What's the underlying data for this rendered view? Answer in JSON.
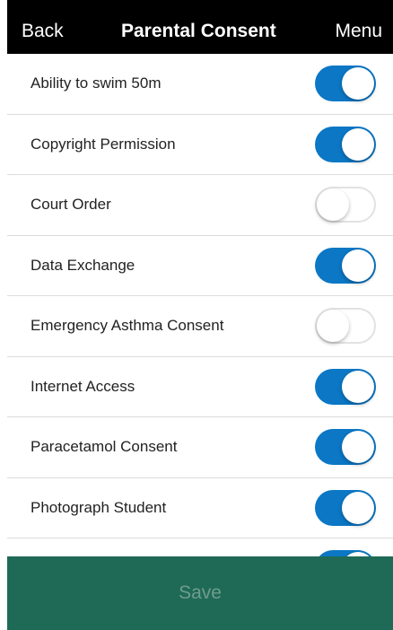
{
  "nav": {
    "back_label": "Back",
    "title": "Parental Consent",
    "menu_label": "Menu"
  },
  "consents": [
    {
      "label": "Ability to swim 50m",
      "enabled": true
    },
    {
      "label": "Copyright Permission",
      "enabled": true
    },
    {
      "label": "Court Order",
      "enabled": false
    },
    {
      "label": "Data Exchange",
      "enabled": true
    },
    {
      "label": "Emergency Asthma Consent",
      "enabled": false
    },
    {
      "label": "Internet Access",
      "enabled": true
    },
    {
      "label": "Paracetamol Consent",
      "enabled": true
    },
    {
      "label": "Photograph Student",
      "enabled": true
    },
    {
      "label": "",
      "enabled": true
    }
  ],
  "footer": {
    "save_label": "Save"
  },
  "colors": {
    "nav_background": "#000000",
    "toggle_on": "#0b77c5",
    "save_bar": "#1e6a56",
    "save_text_disabled": "#6f9c8d"
  }
}
